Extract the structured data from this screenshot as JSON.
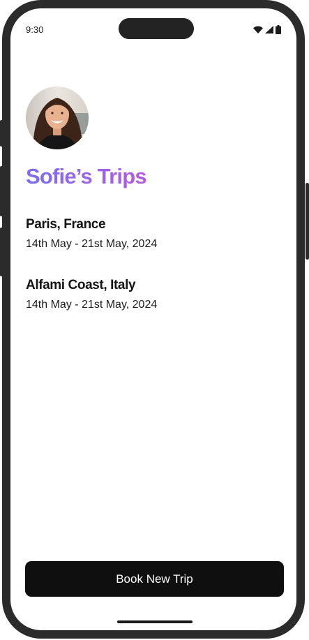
{
  "status_bar": {
    "time": "9:30",
    "icons": [
      "wifi-icon",
      "cellular-signal-icon",
      "battery-icon"
    ]
  },
  "profile": {
    "title": "Sofie’s Trips"
  },
  "trips": [
    {
      "name": "Paris, France",
      "dates": "14th May - 21st May, 2024"
    },
    {
      "name": "Alfami Coast, Italy",
      "dates": "14th May - 21st May, 2024"
    }
  ],
  "actions": {
    "book_label": "Book New Trip"
  },
  "colors": {
    "title_gradient_start": "#7b6ff0",
    "title_gradient_end": "#b45be0",
    "button_background": "#0f0f0f",
    "device_frame": "#2b2b2b"
  }
}
